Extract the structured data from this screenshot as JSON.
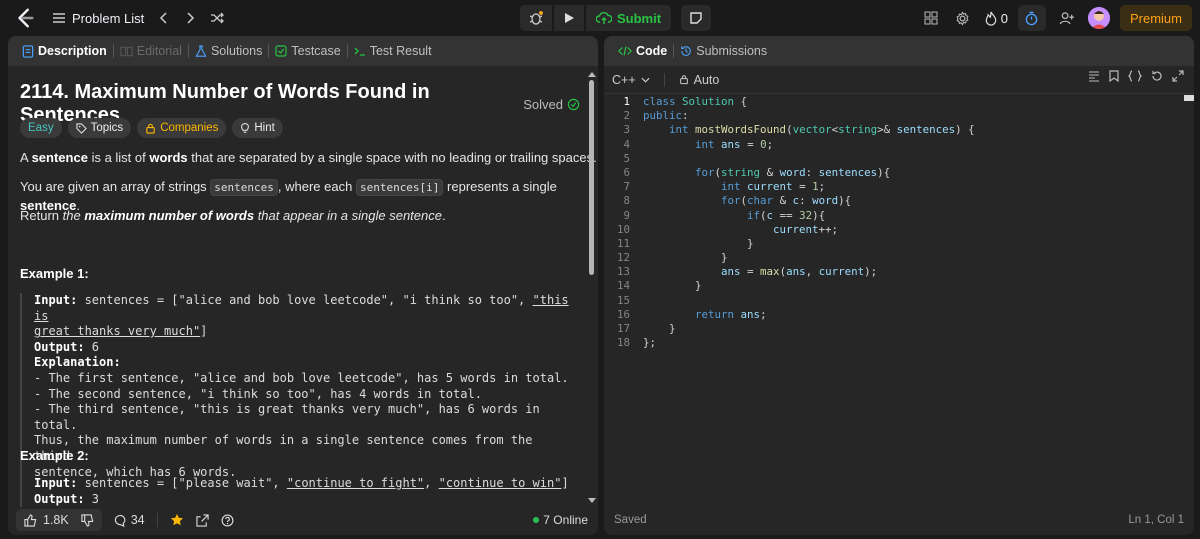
{
  "nav": {
    "problem_list": "Problem List",
    "submit": "Submit",
    "streak_count": "0",
    "premium": "Premium"
  },
  "left_tabs": [
    {
      "label": "Description"
    },
    {
      "label": "Editorial"
    },
    {
      "label": "Solutions"
    },
    {
      "label": "Testcase"
    },
    {
      "label": "Test Result"
    }
  ],
  "problem": {
    "title": "2114. Maximum Number of Words Found in Sentences",
    "status": "Solved",
    "tags": {
      "difficulty": "Easy",
      "topics": "Topics",
      "companies": "Companies",
      "hint": "Hint"
    },
    "p1": {
      "a": "A ",
      "b1": "sentence",
      "c": " is a list of ",
      "b2": "words",
      "d": " that are separated by a single space with no leading or trailing spaces."
    },
    "p2": {
      "a": "You are given an array of strings ",
      "code1": "sentences",
      "b": ", where each ",
      "code2": "sentences[i]",
      "c": " represents a single ",
      "bold": "sentence",
      "d": "."
    },
    "p3": {
      "a": "Return ",
      "em": "the ",
      "em_b": "maximum number of words",
      "em2": " that appear in a single sentence",
      "d": "."
    },
    "example1": {
      "title": "Example 1:",
      "input_label": "Input:",
      "input_a": " sentences = [\"alice and bob love leetcode\", \"i think so too\", ",
      "input_u1": "\"this is",
      "input_u2": "great thanks very much\"",
      "input_end": "]",
      "output_label": "Output:",
      "output_value": " 6",
      "explanation_label": "Explanation:",
      "lines": [
        "- The first sentence, \"alice and bob love leetcode\", has 5 words in total.",
        "- The second sentence, \"i think so too\", has 4 words in total.",
        "- The third sentence, \"this is great thanks very much\", has 6 words in total.",
        "Thus, the maximum number of words in a single sentence comes from the third",
        "sentence, which has 6 words."
      ]
    },
    "example2": {
      "title": "Example 2:",
      "input_label": "Input:",
      "input_a": " sentences = [\"please wait\", ",
      "input_u1": "\"continue to fight\"",
      "input_mid": ", ",
      "input_u2": "\"continue to win\"",
      "input_end": "]",
      "output_label": "Output:",
      "output_value": " 3"
    }
  },
  "footer": {
    "likes": "1.8K",
    "comments": "34",
    "online": "7 Online"
  },
  "right_tabs": [
    {
      "label": "Code"
    },
    {
      "label": "Submissions"
    }
  ],
  "editor": {
    "language": "C++",
    "mode": "Auto",
    "status": "Saved",
    "cursor": "Ln 1, Col 1"
  },
  "colors": {
    "submit_green": "#28c244",
    "premium_orange": "#ffa116",
    "easy_teal": "#46c6c2"
  }
}
